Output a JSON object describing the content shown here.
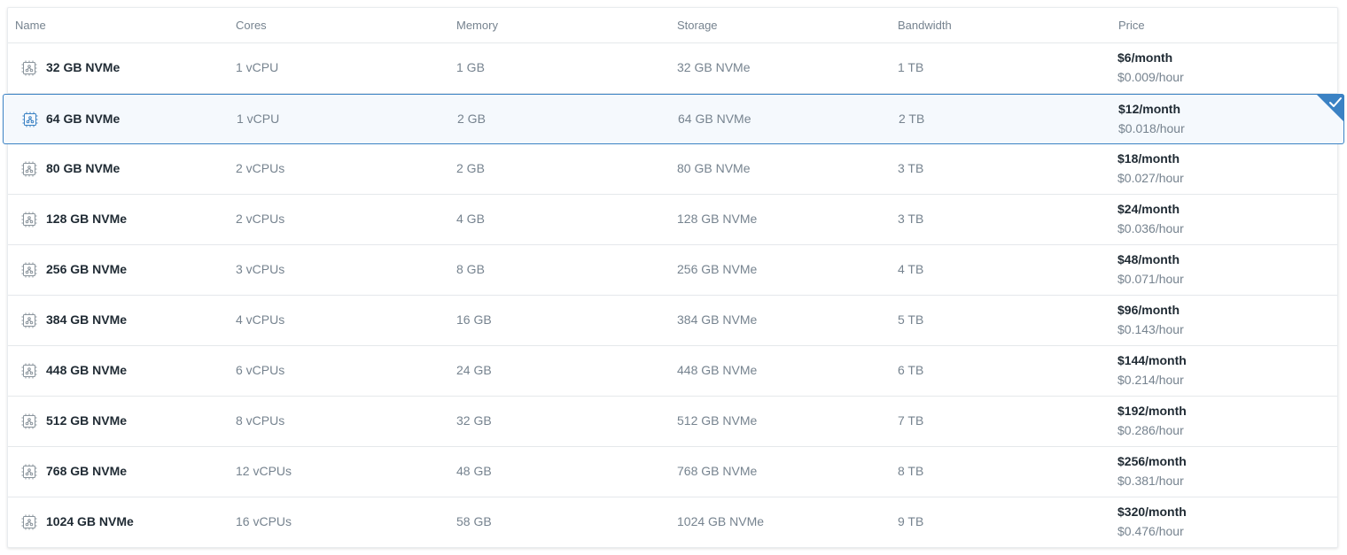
{
  "columns": {
    "name": "Name",
    "cores": "Cores",
    "memory": "Memory",
    "storage": "Storage",
    "bandwidth": "Bandwidth",
    "price": "Price"
  },
  "selected_index": 1,
  "colors": {
    "accent": "#3b82c4",
    "selected_bg": "#f5f9fd",
    "icon": "#8a949c"
  },
  "plans": [
    {
      "name": "32 GB NVMe",
      "cores": "1 vCPU",
      "memory": "1 GB",
      "storage": "32 GB NVMe",
      "bandwidth": "1 TB",
      "price_month": "$6/month",
      "price_hour": "$0.009/hour"
    },
    {
      "name": "64 GB NVMe",
      "cores": "1 vCPU",
      "memory": "2 GB",
      "storage": "64 GB NVMe",
      "bandwidth": "2 TB",
      "price_month": "$12/month",
      "price_hour": "$0.018/hour"
    },
    {
      "name": "80 GB NVMe",
      "cores": "2 vCPUs",
      "memory": "2 GB",
      "storage": "80 GB NVMe",
      "bandwidth": "3 TB",
      "price_month": "$18/month",
      "price_hour": "$0.027/hour"
    },
    {
      "name": "128 GB NVMe",
      "cores": "2 vCPUs",
      "memory": "4 GB",
      "storage": "128 GB NVMe",
      "bandwidth": "3 TB",
      "price_month": "$24/month",
      "price_hour": "$0.036/hour"
    },
    {
      "name": "256 GB NVMe",
      "cores": "3 vCPUs",
      "memory": "8 GB",
      "storage": "256 GB NVMe",
      "bandwidth": "4 TB",
      "price_month": "$48/month",
      "price_hour": "$0.071/hour"
    },
    {
      "name": "384 GB NVMe",
      "cores": "4 vCPUs",
      "memory": "16 GB",
      "storage": "384 GB NVMe",
      "bandwidth": "5 TB",
      "price_month": "$96/month",
      "price_hour": "$0.143/hour"
    },
    {
      "name": "448 GB NVMe",
      "cores": "6 vCPUs",
      "memory": "24 GB",
      "storage": "448 GB NVMe",
      "bandwidth": "6 TB",
      "price_month": "$144/month",
      "price_hour": "$0.214/hour"
    },
    {
      "name": "512 GB NVMe",
      "cores": "8 vCPUs",
      "memory": "32 GB",
      "storage": "512 GB NVMe",
      "bandwidth": "7 TB",
      "price_month": "$192/month",
      "price_hour": "$0.286/hour"
    },
    {
      "name": "768 GB NVMe",
      "cores": "12 vCPUs",
      "memory": "48 GB",
      "storage": "768 GB NVMe",
      "bandwidth": "8 TB",
      "price_month": "$256/month",
      "price_hour": "$0.381/hour"
    },
    {
      "name": "1024 GB NVMe",
      "cores": "16 vCPUs",
      "memory": "58 GB",
      "storage": "1024 GB NVMe",
      "bandwidth": "9 TB",
      "price_month": "$320/month",
      "price_hour": "$0.476/hour"
    }
  ]
}
